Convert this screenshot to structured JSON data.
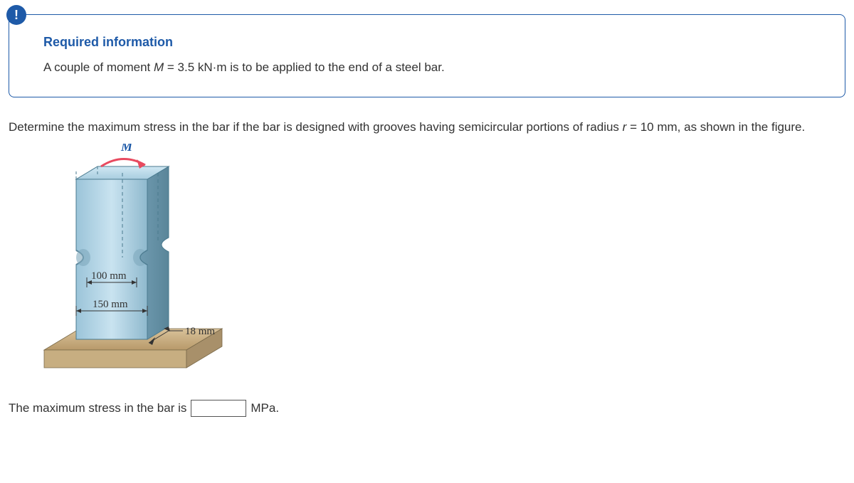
{
  "infoBox": {
    "alertIcon": "!",
    "heading": "Required information",
    "text_prefix": "A couple of moment ",
    "text_var": "M",
    "text_suffix": " = 3.5 kN·m is to be applied to the end of a steel bar."
  },
  "question": {
    "text_prefix": "Determine the maximum stress in the bar if the bar is designed with grooves having semicircular portions of radius ",
    "text_var": "r",
    "text_suffix": " = 10 mm, as shown in the figure."
  },
  "diagram": {
    "label_M": "M",
    "dim_100": "100 mm",
    "dim_150": "150 mm",
    "dim_18": "18 mm"
  },
  "answer": {
    "prefix": "The maximum stress in the bar is",
    "value": "",
    "unit": "MPa."
  }
}
